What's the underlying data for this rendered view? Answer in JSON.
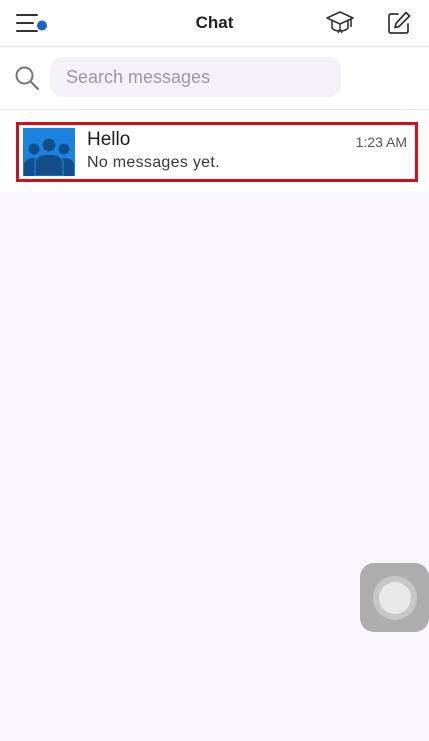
{
  "header": {
    "title": "Chat",
    "menu_icon": "hamburger-menu-icon",
    "notification_dot_color": "#1a63c9",
    "education_icon": "graduation-cap-icon",
    "compose_icon": "compose-icon"
  },
  "search": {
    "placeholder": "Search messages",
    "value": "",
    "icon": "search-icon"
  },
  "chats": [
    {
      "name": "Hello",
      "time": "1:23 AM",
      "preview": "No messages yet.",
      "avatar_icon": "group-avatar-icon",
      "avatar_color": "#1d83e1",
      "highlight_color": "#d40f1c"
    }
  ],
  "overlay": {
    "assistive_touch_icon": "assistive-touch-icon"
  }
}
